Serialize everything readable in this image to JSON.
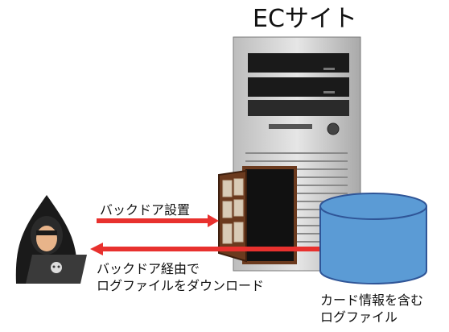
{
  "site": {
    "title": "ECサイト"
  },
  "arrows": {
    "install": "バックドア設置",
    "download_line1": "バックドア経由で",
    "download_line2": "ログファイルをダウンロード"
  },
  "database": {
    "label_line1": "カード情報を含む",
    "label_line2": "ログファイル"
  },
  "colors": {
    "arrow_red": "#e8312e",
    "db_fill": "#5b9bd5",
    "db_stroke": "#2f5597",
    "hacker": "#1a1a1a",
    "door": "#6b3a1e"
  }
}
